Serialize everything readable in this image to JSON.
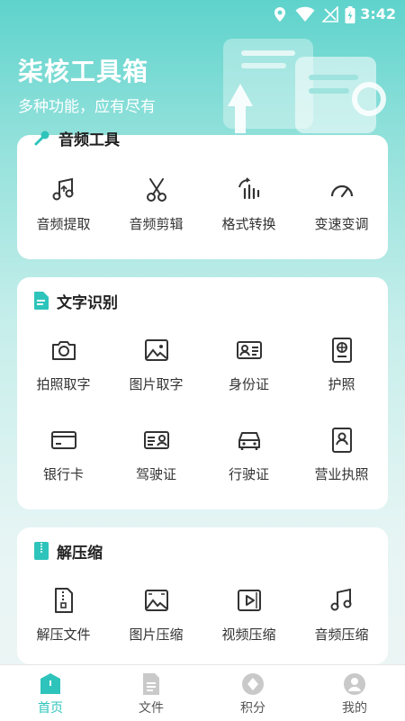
{
  "status_bar": {
    "time": "3:42"
  },
  "header": {
    "title": "柒核工具箱",
    "subtitle": "多种功能，应有尽有"
  },
  "sections": [
    {
      "title": "音频工具",
      "items": [
        {
          "label": "音频提取",
          "icon": "music-note-upload-icon"
        },
        {
          "label": "音频剪辑",
          "icon": "scissors-icon"
        },
        {
          "label": "格式转换",
          "icon": "waveform-convert-icon"
        },
        {
          "label": "变速变调",
          "icon": "speedometer-icon"
        }
      ]
    },
    {
      "title": "文字识别",
      "items": [
        {
          "label": "拍照取字",
          "icon": "camera-icon"
        },
        {
          "label": "图片取字",
          "icon": "image-icon"
        },
        {
          "label": "身份证",
          "icon": "id-card-icon"
        },
        {
          "label": "护照",
          "icon": "passport-icon"
        },
        {
          "label": "银行卡",
          "icon": "bank-card-icon"
        },
        {
          "label": "驾驶证",
          "icon": "driver-license-icon"
        },
        {
          "label": "行驶证",
          "icon": "car-icon"
        },
        {
          "label": "营业执照",
          "icon": "business-license-icon"
        }
      ]
    },
    {
      "title": "解压缩",
      "items": [
        {
          "label": "解压文件",
          "icon": "zip-file-icon"
        },
        {
          "label": "图片压缩",
          "icon": "image-compress-icon"
        },
        {
          "label": "视频压缩",
          "icon": "video-icon"
        },
        {
          "label": "音频压缩",
          "icon": "music-note-icon"
        }
      ]
    }
  ],
  "tabbar": [
    {
      "label": "首页",
      "icon": "home-icon",
      "active": true
    },
    {
      "label": "文件",
      "icon": "file-icon",
      "active": false
    },
    {
      "label": "积分",
      "icon": "points-icon",
      "active": false
    },
    {
      "label": "我的",
      "icon": "user-icon",
      "active": false
    }
  ],
  "colors": {
    "accent": "#2ec4bb",
    "header": "#5ed3cc",
    "icon": "#333333"
  }
}
